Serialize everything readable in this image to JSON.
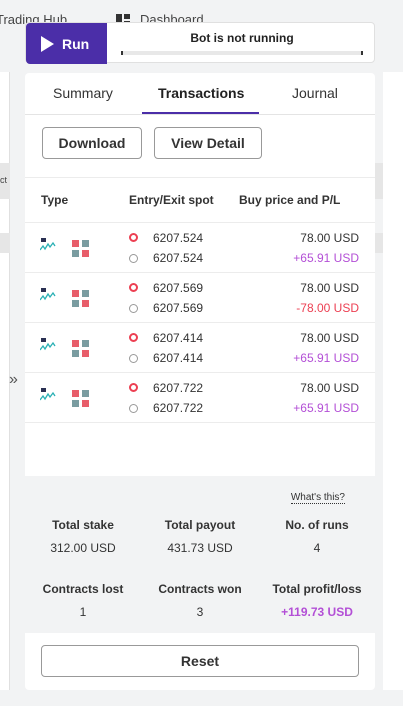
{
  "background": {
    "tab_trading_hub": "Trading Hub",
    "tab_dashboard": "Dashboard",
    "left_strip_text": "ct"
  },
  "run_bar": {
    "run_label": "Run",
    "status_text": "Bot is not running"
  },
  "tabs": [
    {
      "label": "Summary",
      "active": false
    },
    {
      "label": "Transactions",
      "active": true
    },
    {
      "label": "Journal",
      "active": false
    }
  ],
  "actions": {
    "download_label": "Download",
    "view_detail_label": "View Detail"
  },
  "table": {
    "headers": {
      "type": "Type",
      "entry_exit": "Entry/Exit spot",
      "buy_pl": "Buy price and P/L"
    },
    "rows": [
      {
        "entry": "6207.524",
        "exit": "6207.524",
        "buy_price": "78.00 USD",
        "pl": "+65.91 USD",
        "pl_type": "profit"
      },
      {
        "entry": "6207.569",
        "exit": "6207.569",
        "buy_price": "78.00 USD",
        "pl": "-78.00 USD",
        "pl_type": "loss"
      },
      {
        "entry": "6207.414",
        "exit": "6207.414",
        "buy_price": "78.00 USD",
        "pl": "+65.91 USD",
        "pl_type": "profit"
      },
      {
        "entry": "6207.722",
        "exit": "6207.722",
        "buy_price": "78.00 USD",
        "pl": "+65.91 USD",
        "pl_type": "profit"
      }
    ]
  },
  "summary": {
    "whats_this": "What's this?",
    "total_stake_label": "Total stake",
    "total_stake": "312.00 USD",
    "total_payout_label": "Total payout",
    "total_payout": "431.73 USD",
    "runs_label": "No. of runs",
    "runs": "4",
    "contracts_lost_label": "Contracts lost",
    "contracts_lost": "1",
    "contracts_won_label": "Contracts won",
    "contracts_won": "3",
    "profit_label": "Total profit/loss",
    "profit": "+119.73 USD"
  },
  "reset_label": "Reset",
  "colors": {
    "accent": "#4b2ea8",
    "profit": "#b34fd6",
    "loss": "#ec3f52",
    "entry_marker": "#ec3f52"
  }
}
